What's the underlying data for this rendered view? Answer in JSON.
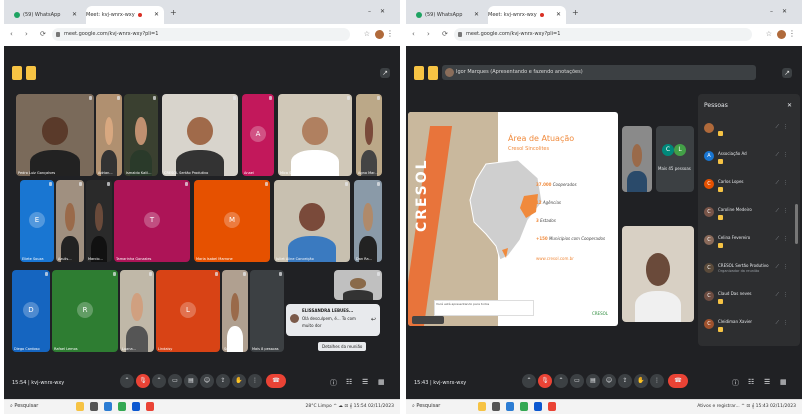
{
  "left": {
    "tabs": [
      {
        "label": "(59) WhatsApp"
      },
      {
        "label": "Meet: kvj-wnrx-wxy"
      }
    ],
    "url": "meet.google.com/kvj-wnrx-wxy?pli=1",
    "tiles": [
      {
        "name": "Pedro Luiz Gonçalves",
        "kind": "video",
        "bg": "#7a6a5a",
        "skin": "#5a3a2a",
        "shirt": "#222"
      },
      {
        "name": "Adrian...",
        "kind": "video",
        "bg": "#b09070",
        "skin": "#d8a880",
        "shirt": "#333"
      },
      {
        "name": "Ismaldo Kalil...",
        "kind": "video",
        "bg": "#3a4030",
        "skin": "#c09070",
        "shirt": "#2a3a2a"
      },
      {
        "name": "CRESOL Sertão Produtivo",
        "kind": "video",
        "bg": "#d8d4cc",
        "skin": "#a06a4a",
        "shirt": "#333"
      },
      {
        "name": "Anael",
        "kind": "avatar",
        "letter": "A",
        "bg": "#c2185b"
      },
      {
        "name": "Mica Soliz...",
        "kind": "video",
        "bg": "#d0c8b8",
        "skin": "#b08060",
        "shirt": "#fff"
      },
      {
        "name": "Agno Mar...",
        "kind": "video",
        "bg": "#bba888",
        "skin": "#7a4a3a",
        "shirt": "#444"
      },
      {
        "name": "Eliete Souza",
        "kind": "avatar",
        "letter": "E",
        "bg": "#1976d2"
      },
      {
        "name": "Azulis...",
        "kind": "video",
        "bg": "#a09080",
        "skin": "#9a6a4a",
        "shirt": "#222"
      },
      {
        "name": "Marcio...",
        "kind": "video",
        "bg": "#2a2a2a",
        "skin": "#6a4a3a",
        "shirt": "#111"
      },
      {
        "name": "Tamarinha Gonzales",
        "kind": "avatar",
        "letter": "T",
        "bg": "#ad1457"
      },
      {
        "name": "Maria Isabel Marrone",
        "kind": "avatar",
        "letter": "M",
        "bg": "#e65100"
      },
      {
        "name": "Juliet Aline Conceição",
        "kind": "video",
        "bg": "#c8c0b0",
        "skin": "#7a4a3a",
        "shirt": "#3a7ac0"
      },
      {
        "name": "Dan Ra...",
        "kind": "video",
        "bg": "#8a9aa8",
        "skin": "#b08a6a",
        "shirt": "#222"
      },
      {
        "name": "Diego Cardoso",
        "kind": "avatar",
        "letter": "D",
        "bg": "#1565c0"
      },
      {
        "name": "Rafael Lemos",
        "kind": "avatar",
        "letter": "R",
        "bg": "#2e7d32"
      },
      {
        "name": "Luana...",
        "kind": "video",
        "bg": "#c0b8a8",
        "skin": "#d0a080",
        "shirt": "#555"
      },
      {
        "name": "Lindaisy",
        "kind": "avatar",
        "letter": "L",
        "bg": "#d84315"
      },
      {
        "name": "Sonia E...",
        "kind": "video",
        "bg": "#b0a090",
        "skin": "#9a6a4a",
        "shirt": "#fff"
      },
      {
        "name": "Mais 8 pessoas",
        "kind": "avatar",
        "letter": "",
        "bg": "#3c4043"
      },
      {
        "name": "",
        "kind": "video",
        "bg": "#c0c0c0",
        "skin": "#8a6a4a",
        "shirt": "#333"
      }
    ],
    "notification": {
      "name": "ELISSANDRA LEBUES...",
      "line1": "Olá desculpem, é... To com",
      "line2": "muito dor"
    },
    "tooltip": "Detalhes da reunião",
    "clock": "15:54 | kvj-wnrx-wxy",
    "taskbar": {
      "search": "Pesquisar",
      "tray": "28°C Limpo  ^  ☁ ⊡ 𝄞  15:54  02/11/2023"
    }
  },
  "right": {
    "tabs": [
      {
        "label": "(59) WhatsApp"
      },
      {
        "label": "Meet: kvj-wnrx-wxy"
      }
    ],
    "url": "meet.google.com/kvj-wnrx-wxy?pli=1",
    "presenter": "Igor Marques (Apresentando e fazendo anotações)",
    "slide": {
      "title": "Área de Atuação",
      "subtitle": "Cresol Sincolites",
      "banner": "CRESOL",
      "bullets": [
        {
          "num": "37.000",
          "text": "Cooperados"
        },
        {
          "num": "12",
          "text": "Agências"
        },
        {
          "num": "3",
          "text": "Estados"
        },
        {
          "num": "+150",
          "text": "Municípios com Cooperados"
        },
        {
          "num": "",
          "text": "www.cresol.com.br"
        }
      ],
      "logo": "CRESOL",
      "caption": "Você está apresentando para todos"
    },
    "more_people": "Mais 45 pessoas",
    "more_initials": [
      "C",
      "L"
    ],
    "people_panel": {
      "title": "Pessoas",
      "people": [
        {
          "name": "",
          "sub": "",
          "letter": "",
          "color": "#b06a3b"
        },
        {
          "name": "Associação Ad",
          "sub": "",
          "letter": "A",
          "color": "#1976d2"
        },
        {
          "name": "Carlos Lopes",
          "sub": "",
          "letter": "C",
          "color": "#e65100"
        },
        {
          "name": "Caroline Medeiro",
          "sub": "",
          "letter": "C",
          "color": "#795548"
        },
        {
          "name": "Celina Fevereiro",
          "sub": "",
          "letter": "C",
          "color": "#8a6a5a"
        },
        {
          "name": "CRESOL Sertão Produtivo",
          "sub": "Organizador da reunião",
          "letter": "C",
          "color": "#5a4a3a"
        },
        {
          "name": "Claud Das neves",
          "sub": "",
          "letter": "C",
          "color": "#6d4c41"
        },
        {
          "name": "Cleidiman Xavier",
          "sub": "",
          "letter": "C",
          "color": "#a0522d"
        }
      ]
    },
    "clock": "15:43 | kvj-wnrx-wxy",
    "taskbar": {
      "search": "Pesquisar",
      "tray": "Ativos e registrar...  ^  ⊡ 𝄞  15:43  02/11/2023"
    }
  }
}
